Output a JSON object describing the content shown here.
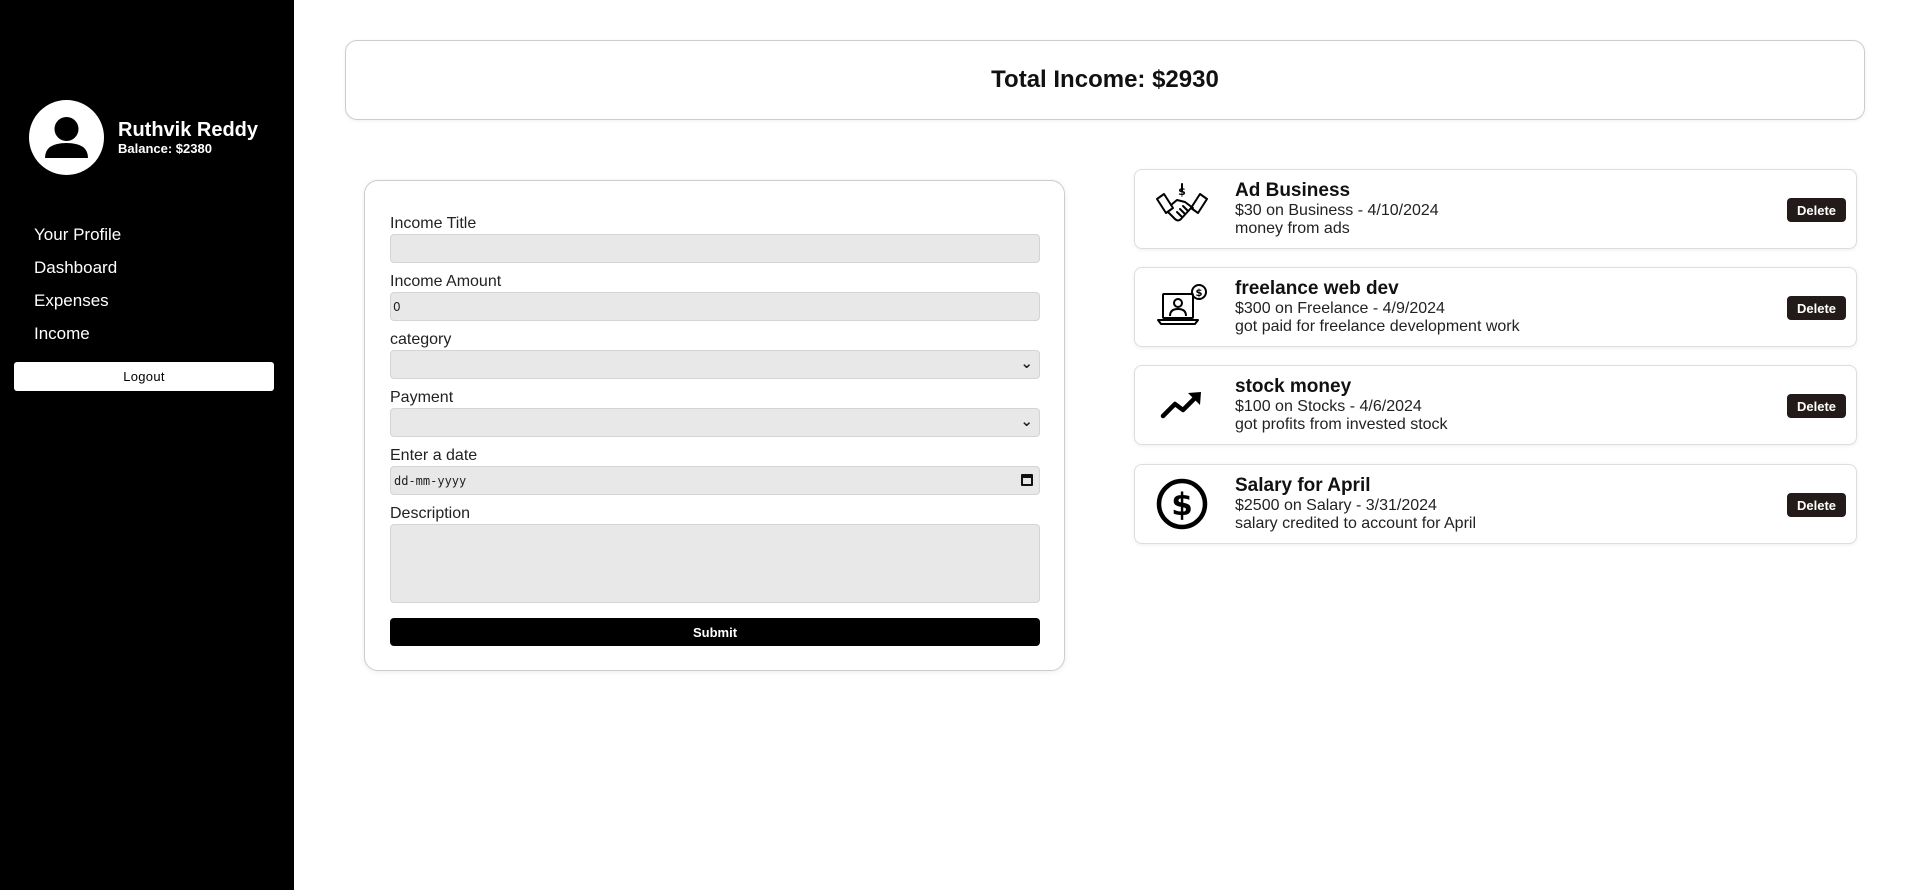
{
  "sidebar": {
    "user_name": "Ruthvik Reddy",
    "balance": "Balance: $2380",
    "nav": [
      "Your Profile",
      "Dashboard",
      "Expenses",
      "Income"
    ],
    "logout_label": "Logout"
  },
  "summary": {
    "total_income": "Total Income: $2930"
  },
  "form": {
    "title_label": "Income Title",
    "title_value": "",
    "amount_label": "Income Amount",
    "amount_value": "0",
    "category_label": "category",
    "category_value": "",
    "payment_label": "Payment",
    "payment_value": "",
    "date_label": "Enter a date",
    "date_placeholder": "dd-mm-yyyy",
    "description_label": "Description",
    "description_value": "",
    "submit_label": "Submit"
  },
  "incomes": [
    {
      "icon": "handshake-dollar-icon",
      "title": "Ad Business",
      "meta": "$30 on Business - 4/10/2024",
      "description": "money from ads",
      "delete_label": "Delete"
    },
    {
      "icon": "laptop-freelancer-icon",
      "title": "freelance web dev",
      "meta": "$300 on Freelance - 4/9/2024",
      "description": "got paid for freelance development work",
      "delete_label": "Delete"
    },
    {
      "icon": "trending-up-icon",
      "title": "stock money",
      "meta": "$100 on Stocks - 4/6/2024",
      "description": "got profits from invested stock",
      "delete_label": "Delete"
    },
    {
      "icon": "dollar-circle-icon",
      "title": "Salary for April",
      "meta": "$2500 on Salary - 3/31/2024",
      "description": "salary credited to account for April",
      "delete_label": "Delete"
    }
  ],
  "colors": {
    "sidebar_bg": "#000000",
    "delete_bg": "#231a1a",
    "field_bg": "#e8e8e8"
  }
}
